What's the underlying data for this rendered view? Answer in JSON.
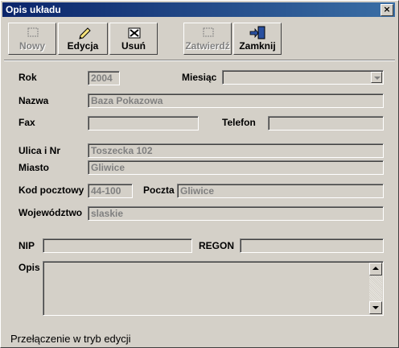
{
  "window": {
    "title": "Opis układu",
    "close_glyph": "×"
  },
  "toolbar": {
    "new": {
      "label": "Nowy",
      "icon": "new-doc-icon",
      "enabled": false
    },
    "edit": {
      "label": "Edycja",
      "icon": "pencil-icon",
      "enabled": true
    },
    "delete": {
      "label": "Usuń",
      "icon": "delete-icon",
      "enabled": true
    },
    "confirm": {
      "label": "Zatwierdź",
      "icon": "confirm-icon",
      "enabled": false
    },
    "close": {
      "label": "Zamknij",
      "icon": "exit-door-icon",
      "enabled": true
    }
  },
  "form": {
    "rok": {
      "label": "Rok",
      "value": "2004"
    },
    "miesiac": {
      "label": "Miesiąc",
      "value": ""
    },
    "nazwa": {
      "label": "Nazwa",
      "value": "Baza Pokazowa"
    },
    "fax": {
      "label": "Fax",
      "value": ""
    },
    "telefon": {
      "label": "Telefon",
      "value": ""
    },
    "ulica": {
      "label": "Ulica i Nr",
      "value": "Toszecka 102"
    },
    "miasto": {
      "label": "Miasto",
      "value": "Gliwice"
    },
    "kod": {
      "label": "Kod pocztowy",
      "value": "44-100"
    },
    "poczta": {
      "label": "Poczta",
      "value": "Gliwice"
    },
    "wojewodztwo": {
      "label": "Województwo",
      "value": "slaskie"
    },
    "nip": {
      "label": "NIP",
      "value": ""
    },
    "regon": {
      "label": "REGON",
      "value": ""
    },
    "opis": {
      "label": "Opis",
      "value": ""
    }
  },
  "status": {
    "text": "Przełączenie w tryb edycji"
  },
  "colors": {
    "titlebar_start": "#0a246a",
    "titlebar_end": "#3a6ea5",
    "face": "#d4d0c8",
    "disabled_text": "#808080"
  }
}
